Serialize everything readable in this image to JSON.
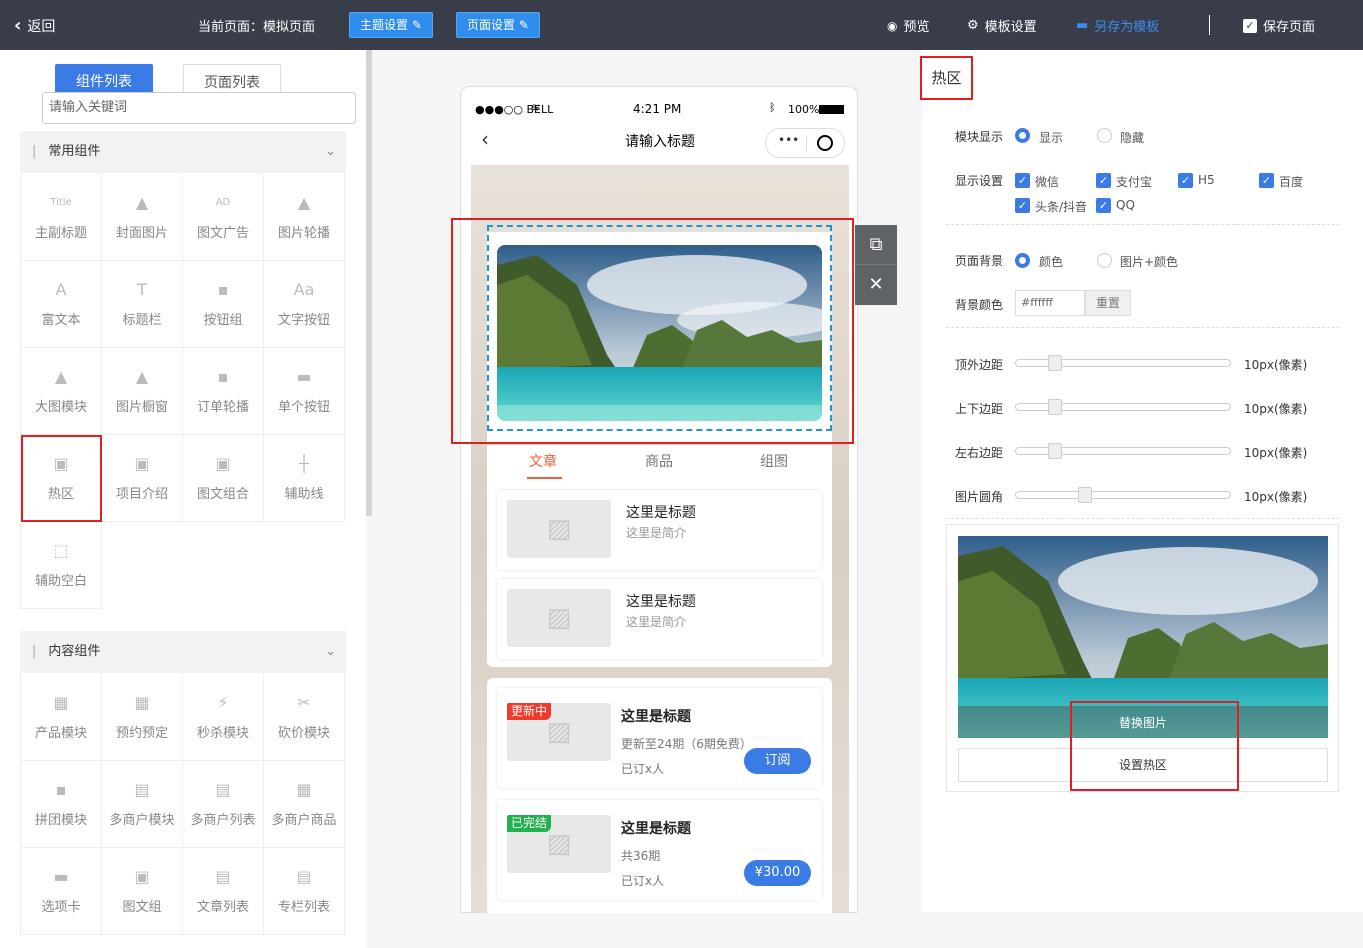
{
  "topbar": {
    "back": "返回",
    "current_page": "当前页面：模拟页面",
    "theme_btn": "主题设置",
    "page_btn": "页面设置",
    "preview": "预览",
    "template_settings": "模板设置",
    "save_as_template": "另存为模板",
    "save_page": "保存页面"
  },
  "left": {
    "tab_components": "组件列表",
    "tab_pages": "页面列表",
    "common_title": "常用组件",
    "common_items": [
      "主副标题",
      "封面图片",
      "图文广告",
      "图片轮播",
      "富文本",
      "标题栏",
      "按钮组",
      "文字按钮",
      "大图模块",
      "图片橱窗",
      "订单轮播",
      "单个按钮",
      "热区",
      "项目介绍",
      "图文组合",
      "辅助线",
      "辅助空白"
    ],
    "common_icons": [
      "Title",
      "▲",
      "AD",
      "▲",
      "A",
      "T",
      "▪",
      "Aa",
      "▲",
      "▲",
      "▪",
      "▬",
      "▣",
      "▣",
      "▣",
      "┼",
      "⬚"
    ],
    "content_title": "内容组件",
    "content_items": [
      "产品模块",
      "预约预定",
      "秒杀模块",
      "砍价模块",
      "拼团模块",
      "多商户模块",
      "多商户列表",
      "多商户商品",
      "选项卡",
      "图文组",
      "文章列表",
      "专栏列表"
    ],
    "content_icons": [
      "▦",
      "▦",
      "⚡",
      "✂",
      "▪",
      "▤",
      "▤",
      "▦",
      "▬",
      "▣",
      "▤",
      "▤"
    ]
  },
  "phone": {
    "carrier": "●●●○○ BELL",
    "time": "4:21 PM",
    "battery": "100%",
    "title": "请输入标题",
    "search_placeholder": "请输入关键词",
    "tabs": [
      "文章",
      "商品",
      "组图"
    ],
    "articles": [
      {
        "title": "这里是标题",
        "desc": "这里是简介"
      },
      {
        "title": "这里是标题",
        "desc": "这里是简介"
      }
    ],
    "columns": [
      {
        "badge": "更新中",
        "title": "这里是标题",
        "line1": "更新至24期（6期免费）",
        "line2": "已订x人",
        "btn": "订阅"
      },
      {
        "badge": "已完结",
        "title": "这里是标题",
        "line1": "共36期",
        "line2": "已订x人",
        "btn": "¥30.00"
      }
    ]
  },
  "right": {
    "title": "热区",
    "module_display": "模块显示",
    "show": "显示",
    "hide": "隐藏",
    "display_settings": "显示设置",
    "platforms": [
      "微信",
      "支付宝",
      "H5",
      "百度",
      "头条/抖音",
      "QQ"
    ],
    "page_bg": "页面背景",
    "bg_color_opt": "颜色",
    "bg_img_opt": "图片+颜色",
    "bg_color_label": "背景颜色",
    "bg_color_value": "#ffffff",
    "reset": "重置",
    "sliders": [
      {
        "label": "顶外边距",
        "value": "10px(像素)",
        "level": 0.18
      },
      {
        "label": "上下边距",
        "value": "10px(像素)",
        "level": 0.18
      },
      {
        "label": "左右边距",
        "value": "10px(像素)",
        "level": 0.18
      },
      {
        "label": "图片圆角",
        "value": "10px(像素)",
        "level": 0.32
      }
    ],
    "replace_image": "替换图片",
    "set_hotspot": "设置热区"
  },
  "colors": {
    "accent": "#3b7be6",
    "topbar": "#393d49",
    "highlight": "#e02020"
  }
}
